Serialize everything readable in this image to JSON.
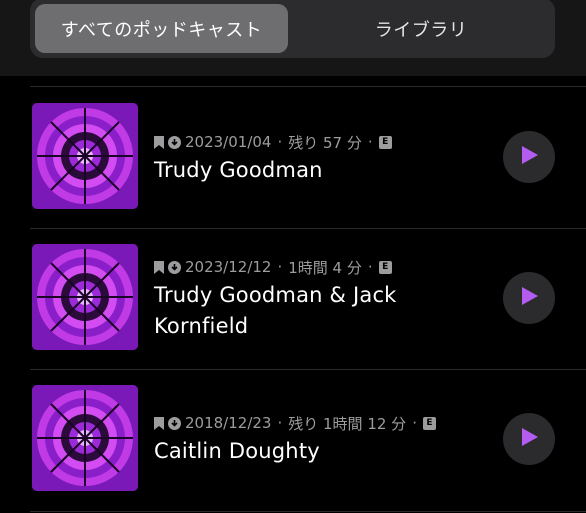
{
  "tabs": {
    "all_podcasts": "すべてのポッドキャスト",
    "library": "ライブラリ"
  },
  "episodes": [
    {
      "date": "2023/01/04",
      "remaining": "残り 57 分",
      "title": "Trudy Goodman",
      "explicit_badge": "E"
    },
    {
      "date": "2023/12/12",
      "remaining": "1時間 4 分",
      "title": "Trudy Goodman & Jack Kornfield",
      "explicit_badge": "E"
    },
    {
      "date": "2018/12/23",
      "remaining": "残り 1時間 12 分",
      "title": "Caitlin Doughty",
      "explicit_badge": "E"
    }
  ],
  "separator": "·",
  "colors": {
    "background": "#000000",
    "accent_purple": "#b45cf0",
    "artwork_purple": "#7b18b8",
    "artwork_magenta": "#d23cf0",
    "meta_gray": "#9d9d9f",
    "play_button_bg": "#2b2b2d"
  },
  "icons": {
    "bookmark": "bookmark-icon",
    "downloaded": "download-icon",
    "explicit": "explicit-icon",
    "play": "play-icon"
  }
}
